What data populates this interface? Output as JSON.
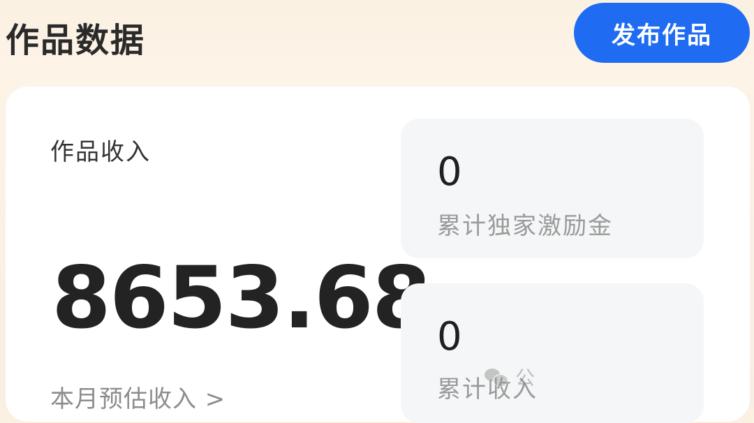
{
  "header": {
    "title": "作品数据",
    "publish_button_label": "发布作品"
  },
  "income": {
    "label": "作品收入",
    "amount": "8653.68",
    "monthly_link": "本月预估收入 >"
  },
  "stats": [
    {
      "value": "0",
      "label": "累计独家激励金"
    },
    {
      "value": "0",
      "label": "累计收入"
    }
  ],
  "watermark": {
    "text": "公",
    "icon": "wechat-icon"
  },
  "colors": {
    "accent": "#1f6bf2",
    "background": "#fbf1e2",
    "card": "#ffffff",
    "panel": "#f5f6f7"
  }
}
